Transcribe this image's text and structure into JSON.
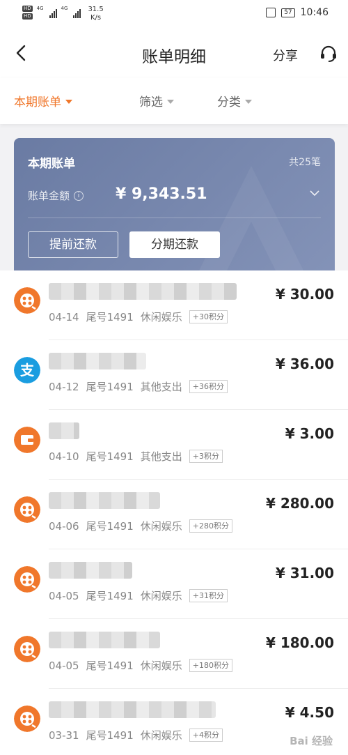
{
  "status_bar": {
    "network_1": "4G",
    "network_2": "4G",
    "speed_value": "31.5",
    "speed_unit": "K/s",
    "battery": "57",
    "time": "10:46"
  },
  "nav": {
    "title": "账单明细",
    "share_label": "分享"
  },
  "filters": {
    "current_period": "本期账单",
    "filter": "筛选",
    "category": "分类",
    "active_color": "#f0772b"
  },
  "bill_card": {
    "title": "本期账单",
    "count": "共25笔",
    "amount_label": "账单金额",
    "amount": "¥ 9,343.51",
    "prepay_label": "提前还款",
    "installment_label": "分期还款"
  },
  "transactions": [
    {
      "icon": "movie-reel-icon",
      "date": "04-14",
      "card": "尾号1491",
      "category": "休闲娱乐",
      "points": "+30积分",
      "amount": "¥ 30.00"
    },
    {
      "icon": "alipay-icon",
      "date": "04-12",
      "card": "尾号1491",
      "category": "其他支出",
      "points": "+36积分",
      "amount": "¥ 36.00"
    },
    {
      "icon": "wallet-icon",
      "date": "04-10",
      "card": "尾号1491",
      "category": "其他支出",
      "points": "+3积分",
      "amount": "¥ 3.00"
    },
    {
      "icon": "movie-reel-icon",
      "date": "04-06",
      "card": "尾号1491",
      "category": "休闲娱乐",
      "points": "+280积分",
      "amount": "¥ 280.00"
    },
    {
      "icon": "movie-reel-icon",
      "date": "04-05",
      "card": "尾号1491",
      "category": "休闲娱乐",
      "points": "+31积分",
      "amount": "¥ 31.00"
    },
    {
      "icon": "movie-reel-icon",
      "date": "04-05",
      "card": "尾号1491",
      "category": "休闲娱乐",
      "points": "+180积分",
      "amount": "¥ 180.00"
    },
    {
      "icon": "movie-reel-icon",
      "date": "03-31",
      "card": "尾号1491",
      "category": "休闲娱乐",
      "points": "+4积分",
      "amount": "¥ 4.50"
    }
  ],
  "colors": {
    "orange": "#f0772b",
    "alipay_blue": "#1a9de0",
    "card_bg": "#7283ad"
  },
  "watermark": "Bai 经验"
}
